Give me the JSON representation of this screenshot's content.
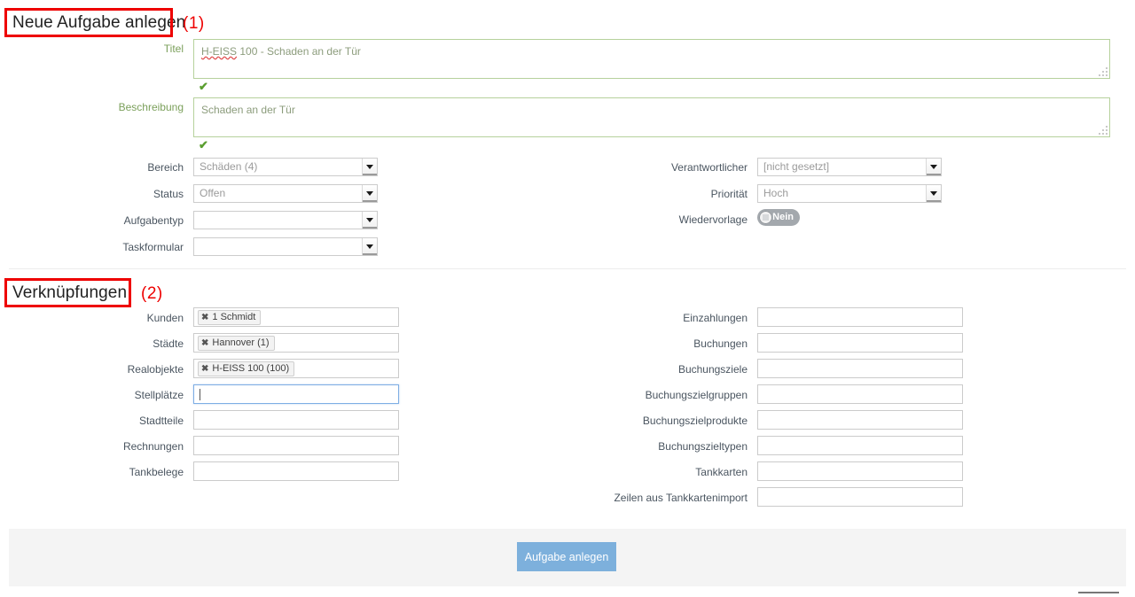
{
  "annotations": [
    {
      "num": "(1)",
      "target": "Neue Aufgabe anlegen"
    },
    {
      "num": "(2)",
      "target": "Verknüpfungen"
    }
  ],
  "sections": {
    "task": {
      "title": "Neue Aufgabe anlegen",
      "fields": {
        "titel": {
          "label": "Titel",
          "value_part1": "H-EISS",
          "value_part2": " 100 - Schaden an der Tür",
          "valid_mark": "✔"
        },
        "beschreibung": {
          "label": "Beschreibung",
          "value": "Schaden an der Tür",
          "valid_mark": "✔"
        },
        "bereich": {
          "label": "Bereich",
          "value": "Schäden (4)"
        },
        "status": {
          "label": "Status",
          "value": "Offen"
        },
        "aufgabentyp": {
          "label": "Aufgabentyp",
          "value": ""
        },
        "taskformular": {
          "label": "Taskformular",
          "value": ""
        },
        "verantwortlicher": {
          "label": "Verantwortlicher",
          "value": "[nicht gesetzt]"
        },
        "prioritaet": {
          "label": "Priorität",
          "value": "Hoch"
        },
        "wiedervorlage": {
          "label": "Wiedervorlage",
          "state": "Nein"
        }
      }
    },
    "links": {
      "title": "Verknüpfungen",
      "left_fields": [
        {
          "label": "Kunden",
          "chips": [
            "1 Schmidt"
          ],
          "focused": false
        },
        {
          "label": "Städte",
          "chips": [
            "Hannover (1)"
          ],
          "focused": false
        },
        {
          "label": "Realobjekte",
          "chips": [
            "H-EISS 100 (100)"
          ],
          "focused": false
        },
        {
          "label": "Stellplätze",
          "chips": [],
          "focused": true
        },
        {
          "label": "Stadtteile",
          "chips": [],
          "focused": false
        },
        {
          "label": "Rechnungen",
          "chips": [],
          "focused": false
        },
        {
          "label": "Tankbelege",
          "chips": [],
          "focused": false
        }
      ],
      "right_fields": [
        {
          "label": "Einzahlungen",
          "chips": [],
          "focused": false
        },
        {
          "label": "Buchungen",
          "chips": [],
          "focused": false
        },
        {
          "label": "Buchungsziele",
          "chips": [],
          "focused": false
        },
        {
          "label": "Buchungszielgruppen",
          "chips": [],
          "focused": false
        },
        {
          "label": "Buchungszielprodukte",
          "chips": [],
          "focused": false
        },
        {
          "label": "Buchungszieltypen",
          "chips": [],
          "focused": false
        },
        {
          "label": "Tankkarten",
          "chips": [],
          "focused": false
        },
        {
          "label": "Zeilen aus Tankkartenimport",
          "chips": [],
          "focused": false
        }
      ]
    }
  },
  "footer": {
    "submit_label": "Aufgabe anlegen"
  },
  "icons": {
    "chip_remove": "✖",
    "select_arrow": "chevron-down-icon",
    "check": "✔"
  },
  "colors": {
    "accent_button": "#7db0dc",
    "annotation": "#ee0000",
    "valid_green": "#5a9e2f",
    "field_green_border": "#b6d19c",
    "focus_blue": "#7eaee4",
    "footer_bg": "#f4f4f4"
  }
}
